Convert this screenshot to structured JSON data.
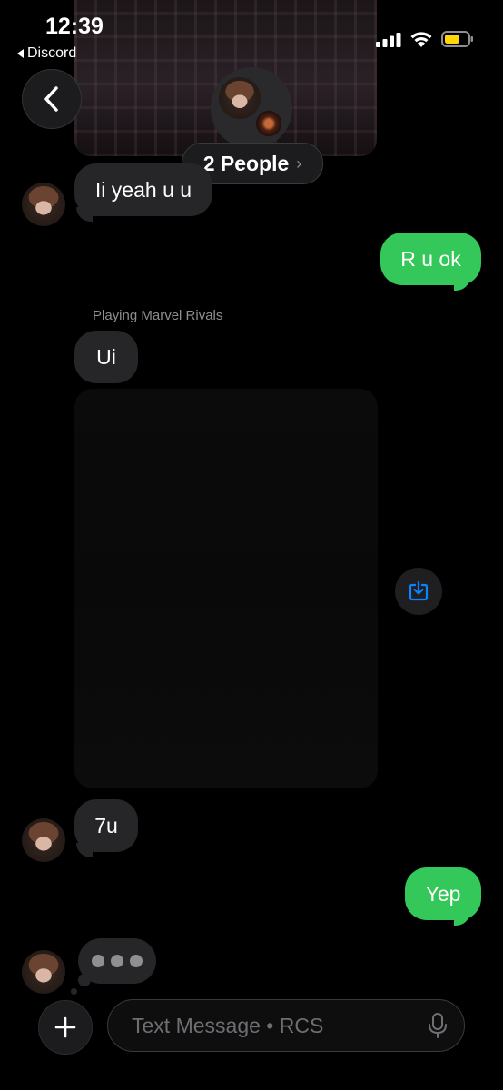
{
  "status_bar": {
    "time": "12:39",
    "back_app": "Discord"
  },
  "header": {
    "people_label": "2 People",
    "chevron": "›"
  },
  "messages": [
    {
      "side": "incoming",
      "text": "Ii yeah u u"
    },
    {
      "side": "outgoing",
      "text": "R u ok"
    },
    {
      "side": "incoming",
      "status_label": "Playing Marvel Rivals",
      "text": "Ui"
    },
    {
      "side": "incoming",
      "text": "7u"
    },
    {
      "side": "outgoing",
      "text": "Yep"
    }
  ],
  "composer": {
    "placeholder": "Text Message • RCS"
  },
  "colors": {
    "incoming_bubble": "#262629",
    "outgoing_bubble": "#34c759",
    "accent_blue": "#0a84ff",
    "battery_fill": "#ffd60a"
  },
  "icons": [
    "back-chevron-icon",
    "signal-icon",
    "wifi-icon",
    "battery-icon",
    "save-download-icon",
    "plus-icon",
    "microphone-icon"
  ]
}
